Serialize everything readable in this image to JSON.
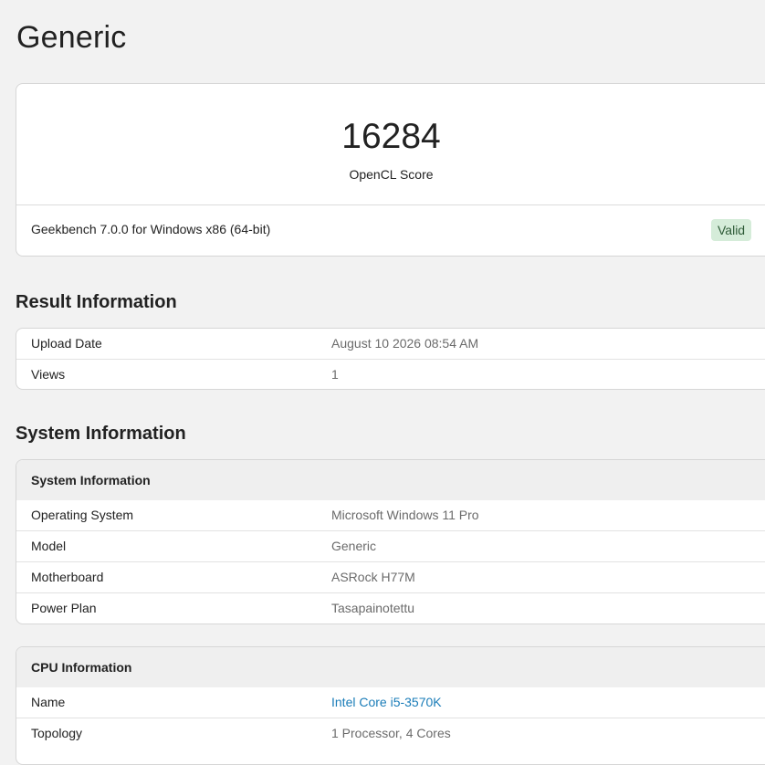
{
  "page": {
    "title": "Generic"
  },
  "score": {
    "value": "16284",
    "label": "OpenCL Score",
    "version_text": "Geekbench 7.0.0 for Windows x86 (64-bit)",
    "status": "Valid"
  },
  "result_info": {
    "heading": "Result Information",
    "rows": [
      {
        "key": "Upload Date",
        "value": "August 10 2026 08:54 AM"
      },
      {
        "key": "Views",
        "value": "1"
      }
    ]
  },
  "system_info": {
    "heading": "System Information",
    "system_table": {
      "title": "System Information",
      "rows": [
        {
          "key": "Operating System",
          "value": "Microsoft Windows 11 Pro"
        },
        {
          "key": "Model",
          "value": "Generic"
        },
        {
          "key": "Motherboard",
          "value": "ASRock H77M"
        },
        {
          "key": "Power Plan",
          "value": "Tasapainotettu"
        }
      ]
    },
    "cpu_table": {
      "title": "CPU Information",
      "rows": [
        {
          "key": "Name",
          "value": "Intel Core i5-3570K"
        },
        {
          "key": "Topology",
          "value": "1 Processor, 4 Cores"
        }
      ]
    }
  },
  "colors": {
    "background": "#f2f2f2",
    "link": "#1a7cb8",
    "valid_badge_bg": "#d5ecd9"
  }
}
